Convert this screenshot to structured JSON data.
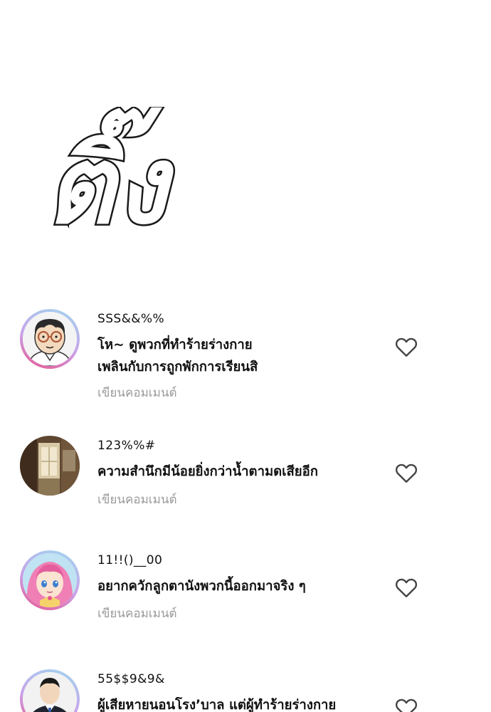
{
  "headline": {
    "text": "ติ๊ง"
  },
  "comments": [
    {
      "username": "SSS&&%%",
      "lines": [
        "โห~ ดูพวกที่ทำร้ายร่างกาย",
        "เพลินกับการถูกพักการเรียนสิ"
      ],
      "reply_label": "เขียนคอมเมนต์",
      "avatar": "man-glasses-avatar",
      "like_icon": "heart-outline-icon"
    },
    {
      "username": "123%%#",
      "lines": [
        "ความสำนึกมีน้อยยิ่งกว่าน้ำตามดเสียอีก"
      ],
      "reply_label": "เขียนคอมเมนต์",
      "avatar": "hallway-photo-avatar",
      "like_icon": "heart-outline-icon"
    },
    {
      "username": "11!!()__00",
      "lines": [
        "อยากควักลูกตานังพวกนี้ออกมาจริง ๆ"
      ],
      "reply_label": "เขียนคอมเมนต์",
      "avatar": "pink-hair-girl-avatar",
      "like_icon": "heart-outline-icon"
    },
    {
      "username": "55$$9&9&",
      "lines": [
        "ผู้เสียหายนอนโรง’บาล แต่ผู้ทำร้ายร่างกาย"
      ],
      "reply_label": "",
      "avatar": "man-suit-avatar",
      "like_icon": "heart-outline-icon"
    }
  ],
  "colors": {
    "text": "#111111",
    "muted": "#9a9a9a",
    "ring_start": "#9fd8f0",
    "ring_end": "#e8568f"
  }
}
